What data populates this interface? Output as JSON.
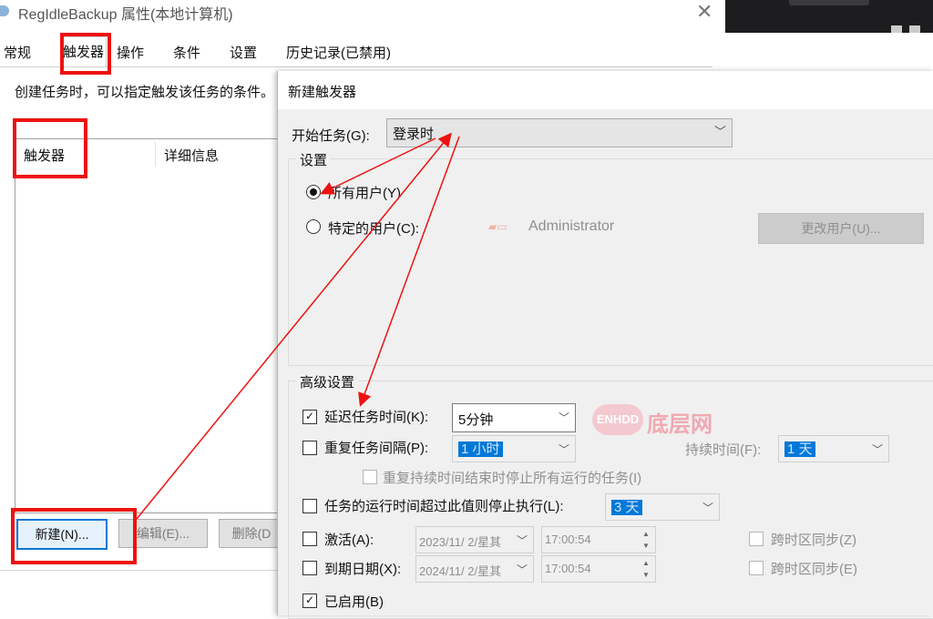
{
  "window": {
    "title": "RegIdleBackup 属性(本地计算机)",
    "close": "✕",
    "tabs": [
      "常规",
      "触发器",
      "操作",
      "条件",
      "设置",
      "历史记录(已禁用)"
    ],
    "description": "创建任务时，可以指定触发该任务的条件。",
    "list_columns": [
      "触发器",
      "详细信息"
    ],
    "buttons": {
      "new": "新建(N)...",
      "edit": "编辑(E)...",
      "delete": "删除(D"
    }
  },
  "dialog": {
    "title": "新建触发器",
    "start_label": "开始任务(G):",
    "start_value": "登录时",
    "settings_group": "设置",
    "radio_all_users": "所有用户(Y)",
    "radio_specific_user": "特定的用户(C):",
    "user_name": "Administrator",
    "change_user_button": "更改用户(U)...",
    "advanced_group": "高级设置",
    "delay_label": "延迟任务时间(K):",
    "delay_value": "5分钟",
    "delay_checked": true,
    "repeat_label": "重复任务间隔(P):",
    "repeat_value": "1 小时",
    "duration_label": "持续时间(F):",
    "duration_value": "1 天",
    "stop_all_label": "重复持续时间结束时停止所有运行的任务(I)",
    "stop_longer_label": "任务的运行时间超过此值则停止执行(L):",
    "stop_longer_value": "3 天",
    "activate_label": "激活(A):",
    "activate_date": "2023/11/  2/星其",
    "activate_time": "17:00:54",
    "activate_tz": "跨时区同步(Z)",
    "expire_label": "到期日期(X):",
    "expire_date": "2024/11/  2/星其",
    "expire_time": "17:00:54",
    "expire_tz": "跨时区同步(E)",
    "enabled_label": "已启用(B)",
    "enabled_checked": true
  },
  "watermark": {
    "badge": "ENHDD",
    "text": "底层网"
  },
  "colors": {
    "annotation_red": "#ee1111",
    "selection_blue": "#0078d7"
  }
}
